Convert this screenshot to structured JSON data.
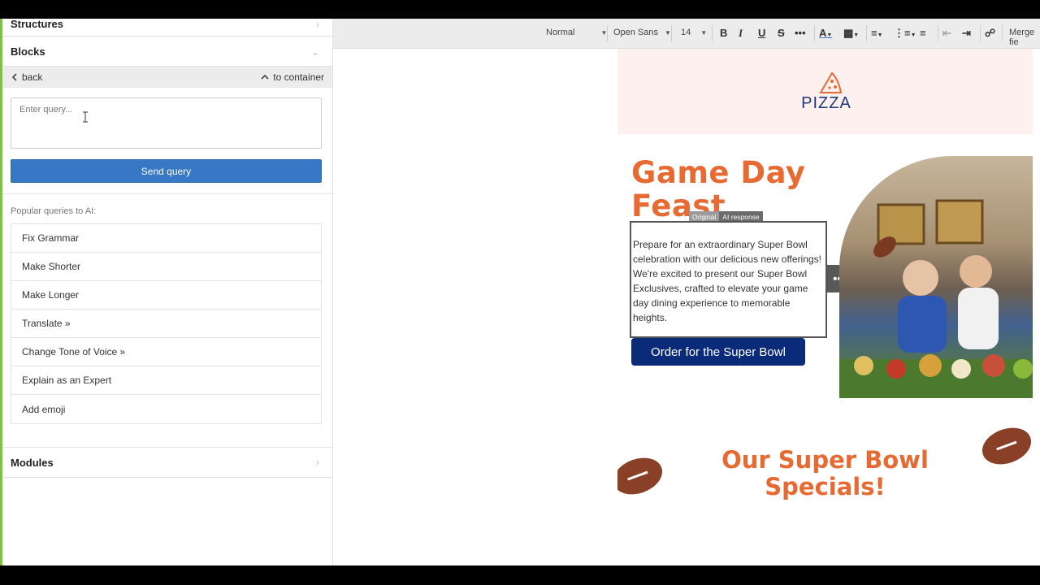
{
  "sidebar": {
    "structures_label": "Structures",
    "blocks_label": "Blocks",
    "back_label": "back",
    "to_container_label": "to container",
    "query_placeholder": "Enter query...",
    "send_label": "Send query",
    "popular_label": "Popular queries to AI:",
    "popular_items": [
      "Fix Grammar",
      "Make Shorter",
      "Make Longer",
      "Translate »",
      "Change Tone of Voice »",
      "Explain as an Expert",
      "Add emoji"
    ],
    "modules_label": "Modules"
  },
  "toolbar": {
    "format": "Normal",
    "font": "Open Sans",
    "size": "14",
    "merge": "Merge fie"
  },
  "email": {
    "logo_text": "PIZZA",
    "hero_title": "Game Day Feast",
    "badge_original": "Original",
    "badge_ai": "AI response",
    "body_text": "Prepare for an extraordinary Super Bowl celebration with our delicious new offerings! We're excited to present our Super Bowl Exclusives, crafted to elevate your game day dining experience to memorable heights.",
    "cta_label": "Order for the Super Bowl",
    "specials_title": "Our Super Bowl Specials!"
  },
  "colors": {
    "accent_green": "#7dc242",
    "button_blue": "#3778c6",
    "brand_orange": "#e86a33",
    "cta_navy": "#0a2a7a"
  }
}
